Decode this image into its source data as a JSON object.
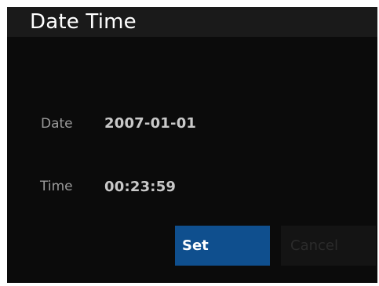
{
  "dialog": {
    "title": "Date Time"
  },
  "fields": {
    "date": {
      "label": "Date",
      "value": "2007-01-01"
    },
    "time": {
      "label": "Time",
      "value": "00:23:59"
    }
  },
  "buttons": {
    "set_label": "Set",
    "cancel_label": "Cancel"
  },
  "colors": {
    "background": "#0b0b0b",
    "titlebar": "#1a1a1a",
    "set_button": "#0f4f8e",
    "cancel_button": "#141414"
  }
}
